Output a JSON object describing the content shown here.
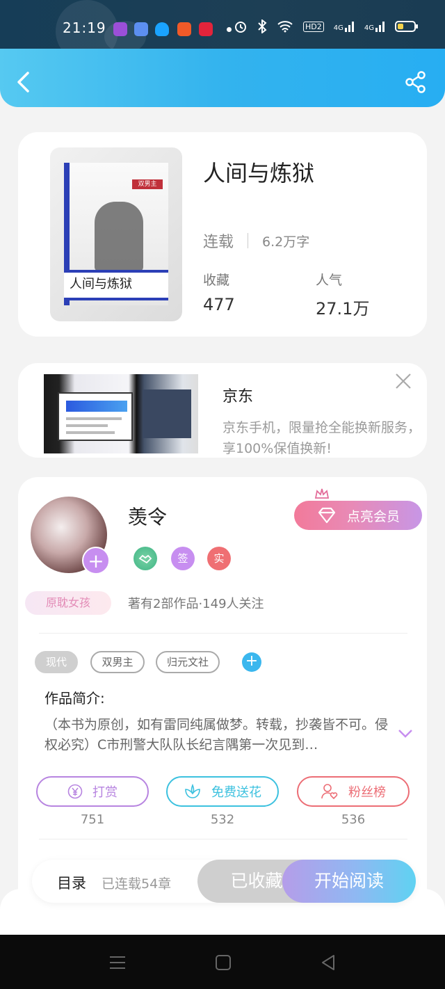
{
  "status_bar": {
    "time": "21:19",
    "network1": "4G",
    "network2": "4G",
    "hd": "HD2"
  },
  "book": {
    "title": "人间与炼狱",
    "status": "连载",
    "word_count": "6.2万字",
    "collect_label": "收藏",
    "collect_value": "477",
    "popularity_label": "人气",
    "popularity_value": "27.1万",
    "cover_title": "人间与炼狱",
    "cover_tag": "双男主"
  },
  "ad": {
    "title": "京东",
    "description": "京东手机，限量抢全能换新服务，享100%保值换新!"
  },
  "author": {
    "name": "羡令",
    "vip_label": "点亮会员",
    "badges": [
      "签",
      "实"
    ],
    "title_tag": "原耽女孩",
    "info": "著有2部作品·149人关注"
  },
  "tags": [
    "现代",
    "双男主",
    "归元文社"
  ],
  "intro": {
    "label": "作品简介:",
    "text": "（本书为原创，如有雷同纯属做梦。转载，抄袭皆不可。侵权必究）C市刑警大队队长纪言隅第一次见到…"
  },
  "actions": [
    {
      "label": "打赏",
      "count": "751",
      "color": "#b784e0"
    },
    {
      "label": "免费送花",
      "count": "532",
      "color": "#3cc1df"
    },
    {
      "label": "粉丝榜",
      "count": "536",
      "color": "#ec6d75"
    }
  ],
  "bottom_bar": {
    "toc_label": "目录",
    "chapters_label": "已连载54章",
    "collected_label": "已收藏",
    "read_label": "开始阅读"
  }
}
